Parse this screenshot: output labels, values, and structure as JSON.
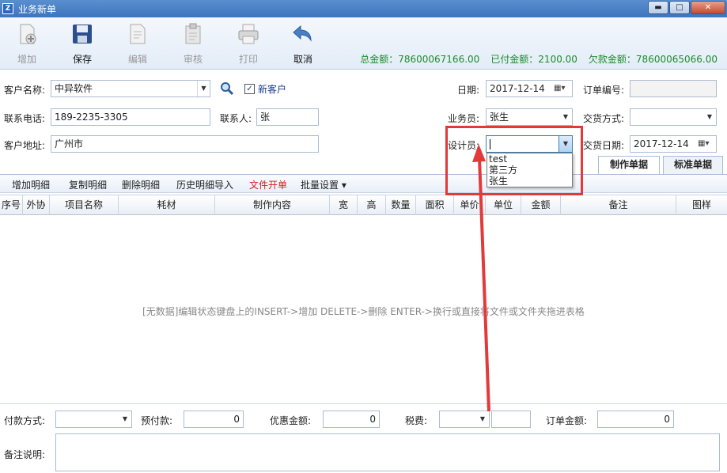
{
  "window": {
    "title": "业务新单",
    "icon_text": "Z",
    "minimize": "▬",
    "maximize": "□",
    "close": "✕"
  },
  "toolbar": {
    "add": "增加",
    "save": "保存",
    "edit": "编辑",
    "review": "审核",
    "print": "打印",
    "cancel": "取消"
  },
  "totals": {
    "total": "总金额：78600067166.00",
    "paid": "已付金额：2100.00",
    "owed": "欠款金额：78600065066.00"
  },
  "form": {
    "customer_label": "客户名称:",
    "customer_value": "中异软件",
    "new_customer_label": "新客户",
    "new_customer_checked": "✓",
    "date_label": "日期:",
    "date_value": "2017-12-14",
    "order_no_label": "订单编号:",
    "order_no_value": "",
    "phone_label": "联系电话:",
    "phone_value": "189-2235-3305",
    "contact_label": "联系人:",
    "contact_value": "张",
    "salesman_label": "业务员:",
    "salesman_value": "张生",
    "delivery_method_label": "交货方式:",
    "delivery_method_value": "",
    "address_label": "客户地址:",
    "address_value": "广州市",
    "designer_label": "设计员:",
    "designer_value": "",
    "delivery_date_label": "交货日期:",
    "delivery_date_value": "2017-12-14"
  },
  "designer_options": [
    "test",
    "第三方",
    "张生"
  ],
  "tabs": {
    "make_order": "制作单据",
    "standard_order": "标准单据"
  },
  "detail_bar": {
    "add_detail": "增加明细",
    "copy_detail": "复制明细",
    "delete_detail": "删除明细",
    "history_import": "历史明细导入",
    "file_order": "文件开单",
    "batch_settings": "批量设置 ▾"
  },
  "grid_columns": [
    "序号",
    "外协",
    "项目名称",
    "耗材",
    "制作内容",
    "宽",
    "高",
    "数量",
    "面积",
    "单价",
    "单位",
    "金额",
    "备注",
    "图样"
  ],
  "grid_empty_message": "[无数据]编辑状态键盘上的INSERT->增加 DELETE->删除 ENTER->换行或直接将文件或文件夹拖进表格",
  "bottom": {
    "payment_method_label": "付款方式:",
    "payment_method_value": "",
    "prepay_label": "预付款:",
    "prepay_value": "0",
    "discount_label": "优惠金额:",
    "discount_value": "0",
    "tax_label": "税费:",
    "tax_value": "",
    "order_amount_label": "订单金额:",
    "order_amount_value": "0",
    "remarks_label": "备注说明:"
  },
  "colors": {
    "totals_green": "#1c8c2a",
    "highlight_red": "#e23a3a",
    "file_order_red": "#d42020"
  }
}
